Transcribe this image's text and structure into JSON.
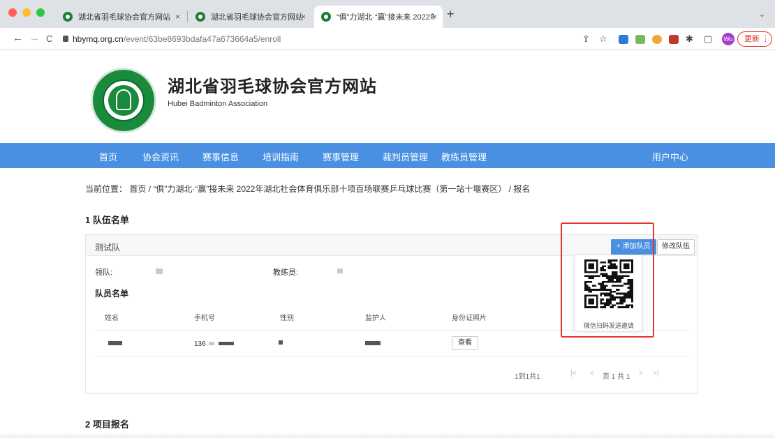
{
  "browser": {
    "tabs": [
      {
        "title": "湖北省羽毛球协会官方网站"
      },
      {
        "title": "湖北省羽毛球协会官方网站"
      },
      {
        "title": "“俱”力湖北·“赢”接未来 2022年"
      }
    ],
    "close_glyph": "×",
    "new_tab_glyph": "+",
    "tab_menu_glyph": "⌄",
    "back_glyph": "←",
    "forward_glyph": "→",
    "reload_glyph": "C",
    "url_host": "hbymq.org.cn",
    "url_path": "/event/63be8693bdafa47a673664a5/enroll",
    "avatar_initials": "Wu",
    "update_label": "更新 ⋮",
    "toolbar_icons": [
      "share-icon",
      "star-icon",
      "extensions-icon",
      "sidebar-icon"
    ],
    "colors": {
      "update": "#d93025",
      "avatar": "#a23ed1"
    }
  },
  "site": {
    "title": "湖北省羽毛球协会官方网站",
    "subtitle": "Hubei Badminton Association",
    "brand_color": "#1a8a3c",
    "nav_color": "#4a90e2"
  },
  "nav": {
    "items": [
      "首页",
      "协会资讯",
      "赛事信息",
      "培训指南",
      "赛事管理",
      "裁判员管理",
      "教练员管理"
    ],
    "user_center": "用户中心"
  },
  "breadcrumb": "当前位置： 首页 / “俱”力湖北·“赢”接未来 2022年湖北社会体育俱乐部十项百场联赛乒乓球比赛（第一站十堰赛区） / 报名",
  "section1_title": "1 队伍名单",
  "section2_title": "2 项目报名",
  "team": {
    "name": "测试队",
    "add_member": "+ 添加队员",
    "edit_team": "修改队伍",
    "leader_label": "领队:",
    "coach_label": "教练员:",
    "roster_title": "队员名单",
    "columns": [
      "姓名",
      "手机号",
      "性别",
      "监护人",
      "身份证照片"
    ],
    "rows": [
      {
        "phone_prefix": "136",
        "view_label": "查看"
      }
    ],
    "pagination": {
      "summary": "1到1共1",
      "first": "|<",
      "prev": "<",
      "page_text": "页 1 共 1",
      "next": ">",
      "last": ">|"
    }
  },
  "qr_popup": {
    "caption": "微信扫码发送邀请"
  }
}
